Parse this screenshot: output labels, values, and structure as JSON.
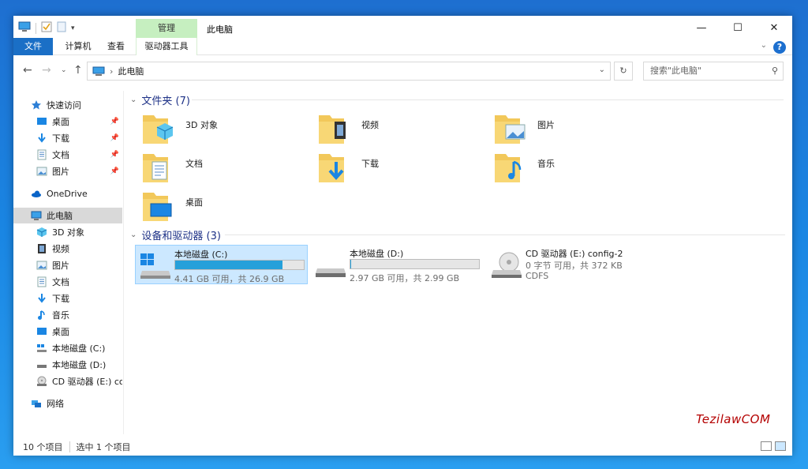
{
  "window": {
    "title": "此电脑",
    "manage_tab": "管理",
    "tabs": [
      "文件",
      "计算机",
      "查看",
      "驱动器工具"
    ]
  },
  "address": {
    "path": "此电脑",
    "search_placeholder": "搜索\"此电脑\""
  },
  "sidebar": {
    "quick_access": "快速访问",
    "quick_items": [
      "桌面",
      "下载",
      "文档",
      "图片"
    ],
    "onedrive": "OneDrive",
    "this_pc": "此电脑",
    "pc_items": [
      "3D 对象",
      "视频",
      "图片",
      "文档",
      "下载",
      "音乐",
      "桌面",
      "本地磁盘 (C:)",
      "本地磁盘 (D:)",
      "CD 驱动器 (E:) con"
    ],
    "network": "网络"
  },
  "content": {
    "folders_header": "文件夹 (7)",
    "folders": [
      "3D 对象",
      "视频",
      "图片",
      "文档",
      "下载",
      "音乐",
      "桌面"
    ],
    "devices_header": "设备和驱动器 (3)",
    "drives": [
      {
        "name": "本地磁盘 (C:)",
        "info": "4.41 GB 可用，共 26.9 GB",
        "used_fraction": 0.836
      },
      {
        "name": "本地磁盘 (D:)",
        "info": "2.97 GB 可用，共 2.99 GB",
        "used_fraction": 0.007
      },
      {
        "name": "CD 驱动器 (E:) config-2",
        "info": "0 字节 可用，共 372 KB",
        "fs": "CDFS"
      }
    ]
  },
  "status": {
    "count": "10 个项目",
    "selected": "选中 1 个项目"
  },
  "watermark": "TezilawCOM",
  "colors": {
    "accent": "#1a6fc6",
    "manage_green": "#c6efc0",
    "selected_drive": "#cce8ff",
    "group_header": "#1e3287",
    "drive_fill": "#26a0da"
  }
}
